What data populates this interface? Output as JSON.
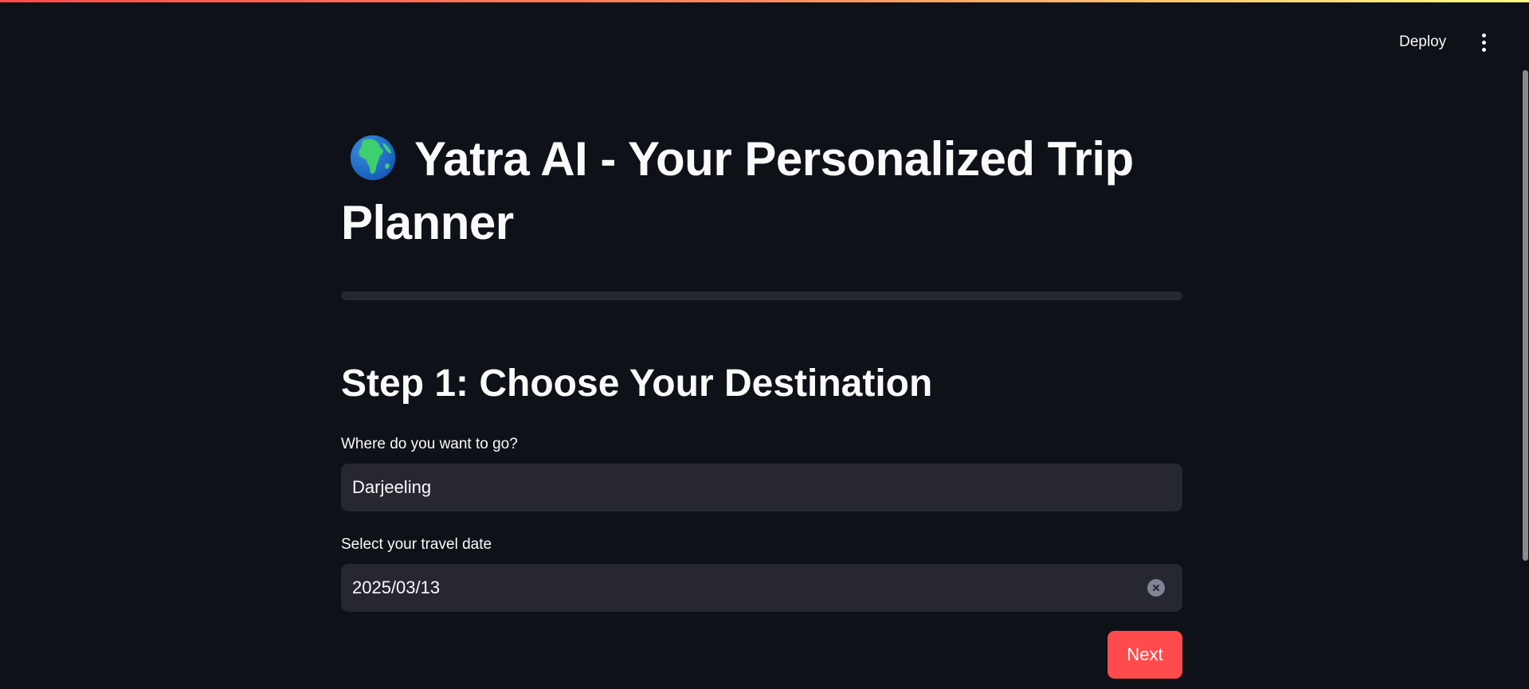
{
  "header": {
    "deploy_label": "Deploy",
    "menu_icon": "vertical-ellipsis-icon"
  },
  "page": {
    "title_icon": "globe-africa-icon",
    "title": "Yatra AI - Your Personalized Trip Planner",
    "step_heading": "Step 1: Choose Your Destination"
  },
  "form": {
    "destination": {
      "label": "Where do you want to go?",
      "value": "Darjeeling"
    },
    "date": {
      "label": "Select your travel date",
      "value": "2025/03/13",
      "clear_icon": "clear-circle-icon"
    },
    "next_label": "Next"
  },
  "colors": {
    "background": "#0e1117",
    "input_background": "#262730",
    "primary": "#ff4b4b",
    "text": "#fafafa"
  }
}
